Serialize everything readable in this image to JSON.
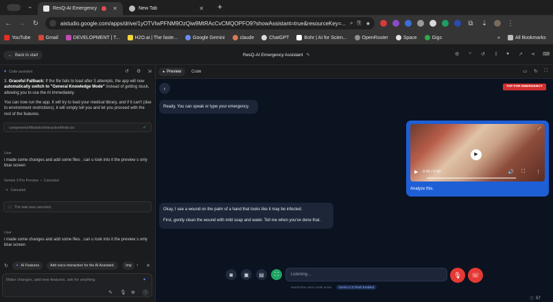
{
  "browser": {
    "tabs": [
      {
        "title": "ResQ-AI Emergency Assis",
        "active": true
      },
      {
        "title": "New Tab",
        "active": false
      }
    ],
    "new_tab_symbol": "+",
    "url": "aistudio.google.com/apps/drive/1yOTVIwPFNM9OzQiw9MtRAcCvCMQOPFO9?showAssistant=true&resourceKey=...",
    "bookmarks": [
      "YouTube",
      "Gmail",
      "DEVELOPMENT | T...",
      "H2O.ai | The faste...",
      "Google Gemini",
      "claude",
      "ChatGPT",
      "Bohr | AI for Scien...",
      "OpenRouter",
      "Space",
      "Gigs"
    ],
    "bookmarks_overflow": "»",
    "all_bookmarks": "All Bookmarks"
  },
  "app": {
    "back_label": "Back to start",
    "title": "ResQ-AI Emergency Assistant"
  },
  "assistant": {
    "header": "Code assistant",
    "fallback_num": "3.",
    "fallback_bold": "Graceful Fallback:",
    "fallback_text1": " If the file fails to load after 3 attempts, the app will now ",
    "fallback_bold2": "automatically switch to \"General Knowledge Mode\"",
    "fallback_text2": " instead of getting stuck, allowing you to use the AI immediately.",
    "run_note": "You can now run the app. It will try to load your medical library, and if it can't (due to environment restrictions), it will simply tell you and let you proceed with the rest of the features.",
    "file_path": "components/Modules/InteractiveMode.tsx",
    "user_label_1": "User",
    "user_msg_1": "i made some changes and add some files , can u look into it the preview s only blue screen",
    "model_label": "Gemini 3 Pro Preview",
    "model_status": "Canceled",
    "canceled_label": "Canceled",
    "task_canceled": "The task was canceled.",
    "user_label_2": "User",
    "user_msg_2": "i made some changes and add some files , can u look into it the preview s only blue screen",
    "chips": [
      "AI Features",
      "Add voice interaction for the AI Assistant.",
      "Imp"
    ],
    "input_placeholder": "Make changes, add new features, ask for anything"
  },
  "preview": {
    "tab_preview": "Preview",
    "tab_code": "Code",
    "emergency_button": "TAP FOR EMERGENCY",
    "bot_greeting": "Ready. You can speak or type your emergency.",
    "video_time": "0:00 / 0:09",
    "user_caption": "Analyze this.",
    "bot_reply_1": "Okay, I see a wound on the palm of a hand that looks like it may be infected.",
    "bot_reply_2": "First, gently clean the wound with mild soap and water. Tell me when you've done that.",
    "input_placeholder": "Listening...",
    "footer_note": "Hands-free voice mode active",
    "model_badge": "Gemini 2.0 Flash Enabled",
    "counter": "57"
  }
}
